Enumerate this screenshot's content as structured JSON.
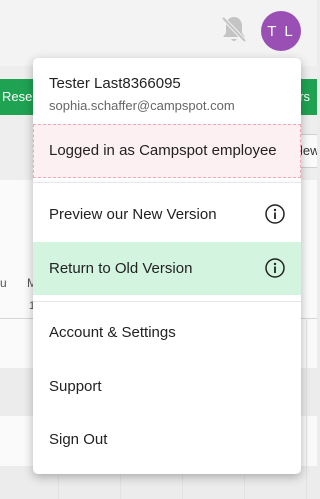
{
  "header": {
    "avatar_initials": "T L",
    "notifications_icon": "bell-off-icon"
  },
  "background": {
    "left_button_partial": "Reser",
    "right_button_partial": "ers",
    "right_field_partial": "lew",
    "column_header_partial": "M",
    "column_header_left_partial": "u",
    "column_sub_partial": "1"
  },
  "user_menu": {
    "name": "Tester Last8366095",
    "email": "sophia.schaffer@campspot.com",
    "employee_notice": "Logged in as Campspot employee",
    "items": [
      {
        "label": "Preview our New Version",
        "icon": "info-icon"
      },
      {
        "label": "Return to Old Version",
        "icon": "info-icon"
      },
      {
        "label": "Account & Settings"
      },
      {
        "label": "Support"
      },
      {
        "label": "Sign Out"
      }
    ]
  },
  "colors": {
    "avatar": "#9a4fb4",
    "primary_green": "#1fa352",
    "highlight": "#d3f5e0",
    "employee_banner": "#fdf0f2"
  }
}
